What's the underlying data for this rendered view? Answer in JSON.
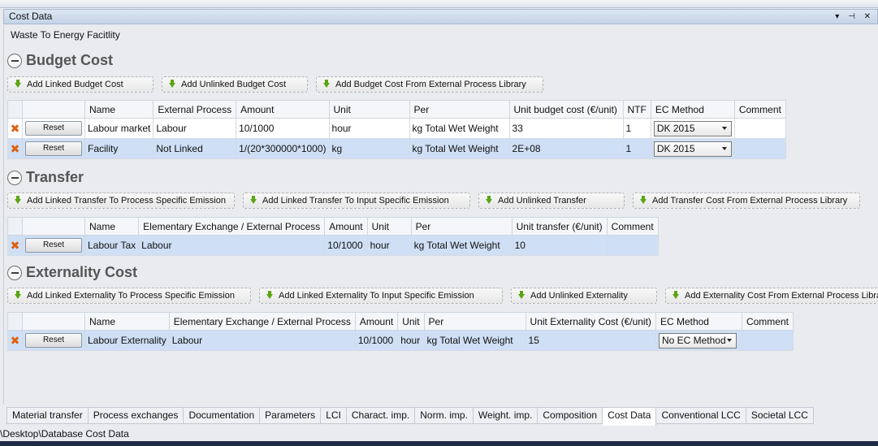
{
  "window": {
    "title": "Cost Data",
    "controls": "▾ ⊣ ✕"
  },
  "facility_name": "Waste To Energy Facitlity",
  "budget": {
    "title": "Budget Cost",
    "buttons": [
      "Add Linked Budget Cost",
      "Add Unlinked Budget Cost",
      "Add Budget Cost From External Process Library"
    ],
    "headers": [
      "Name",
      "External Process",
      "Amount",
      "Unit",
      "Per",
      "Unit budget cost (€/unit)",
      "NTF",
      "EC Method",
      "Comment"
    ],
    "rows": [
      {
        "reset": "Reset",
        "name": "Labour market",
        "ext": "Labour",
        "amount": "10/1000",
        "unit": "hour",
        "per": "kg Total Wet Weight",
        "cost": "33",
        "ntf": "1",
        "ec": "DK 2015",
        "comment": ""
      },
      {
        "reset": "Reset",
        "name": "Facility",
        "ext": "Not Linked",
        "amount": "1/(20*300000*1000)",
        "unit": "kg",
        "per": "kg Total Wet Weight",
        "cost": "2E+08",
        "ntf": "1",
        "ec": "DK 2015",
        "comment": ""
      }
    ]
  },
  "transfer": {
    "title": "Transfer",
    "buttons": [
      "Add Linked Transfer To Process Specific Emission",
      "Add Linked Transfer To Input Specific Emission",
      "Add Unlinked Transfer",
      "Add Transfer Cost From External Process Library"
    ],
    "headers": [
      "Name",
      "Elementary Exchange / External Process",
      "Amount",
      "Unit",
      "Per",
      "Unit transfer (€/unit)",
      "Comment"
    ],
    "rows": [
      {
        "reset": "Reset",
        "name": "Labour Tax",
        "ext": "Labour",
        "amount": "10/1000",
        "unit": "hour",
        "per": "kg Total Wet Weight",
        "cost": "10",
        "comment": ""
      }
    ]
  },
  "externality": {
    "title": "Externality Cost",
    "buttons": [
      "Add Linked Externality To Process Specific Emission",
      "Add Linked Externality To Input Specific Emission",
      "Add Unlinked Externality",
      "Add Externality Cost From External Process Library"
    ],
    "headers": [
      "Name",
      "Elementary Exchange / External Process",
      "Amount",
      "Unit",
      "Per",
      "Unit Externality Cost (€/unit)",
      "EC Method",
      "Comment"
    ],
    "rows": [
      {
        "reset": "Reset",
        "name": "Labour Externality",
        "ext": "Labour",
        "amount": "10/1000",
        "unit": "hour",
        "per": "kg Total Wet Weight",
        "cost": "15",
        "ec": "No EC Method",
        "comment": ""
      }
    ]
  },
  "tabs": [
    "Material transfer",
    "Process exchanges",
    "Documentation",
    "Parameters",
    "LCI",
    "Charact. imp.",
    "Norm. imp.",
    "Weight. imp.",
    "Composition",
    "Cost Data",
    "Conventional LCC",
    "Societal LCC"
  ],
  "active_tab": "Cost Data",
  "path": "\\Desktop\\Database Cost Data",
  "colors": {
    "selected_row": "#cfdff5",
    "delete_icon": "#e06010",
    "arrow_icon": "#5aa513"
  }
}
